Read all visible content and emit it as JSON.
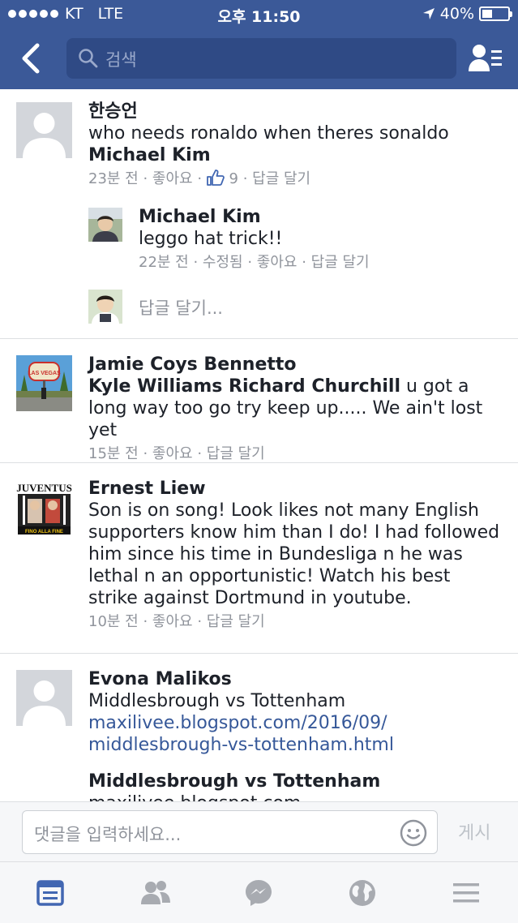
{
  "status_bar": {
    "carrier": "KT",
    "network": "LTE",
    "time": "오후 11:50",
    "battery": "40%",
    "battery_level": 0.4
  },
  "header": {
    "search_placeholder": "검색",
    "icons": [
      "back-arrow-icon",
      "search-icon",
      "friend-requests-icon"
    ]
  },
  "comments": [
    {
      "author": "한승언",
      "text": "who needs ronaldo when theres sonaldo",
      "tagged": "Michael Kim",
      "time": "23분 전",
      "like": "좋아요",
      "like_count": "9",
      "reply": "답글 달기",
      "replies": [
        {
          "author": "Michael Kim",
          "text": "leggo hat trick!!",
          "time": "22분 전",
          "edited": "수정됨",
          "like": "좋아요",
          "reply": "답글 달기"
        }
      ],
      "reply_placeholder": "답글 달기..."
    },
    {
      "author": "Jamie Coys Bennetto",
      "tagged": "Kyle Williams Richard Churchill",
      "text": " u got a long way too go try keep up..... We ain't lost yet",
      "time": "15분 전",
      "like": "좋아요",
      "reply": "답글 달기",
      "avatar_sign": "LAS VEGAS"
    },
    {
      "author": "Ernest Liew",
      "text": "Son is on song! Look likes not many English supporters know him than I do! I had followed him since his time in Bundesliga n he was lethal n an opportunistic! Watch his best strike against Dortmund in youtube.",
      "time": "10분 전",
      "like": "좋아요",
      "reply": "답글 달기",
      "avatar_top": "JUVENTUS",
      "avatar_bottom": "FINO ALLA FINE"
    },
    {
      "author": "Evona Malikos",
      "text": "Middlesbrough vs Tottenham",
      "link_line1": "maxilivee.blogspot.com/2016/09/",
      "link_line2": "middlesbrough-vs-tottenham.html",
      "preview_title": "Middlesbrough vs Tottenham",
      "preview_domain": "maxilivee.blogspot.com"
    }
  ],
  "composer": {
    "placeholder": "댓글을 입력하세요...",
    "post_label": "게시"
  },
  "tabs": [
    "news-feed-icon",
    "friends-icon",
    "messenger-icon",
    "globe-icon",
    "menu-icon"
  ],
  "colors": {
    "header": "#3b5998",
    "link": "#365899",
    "meta": "#90949c",
    "active_tab": "#4267b2"
  }
}
